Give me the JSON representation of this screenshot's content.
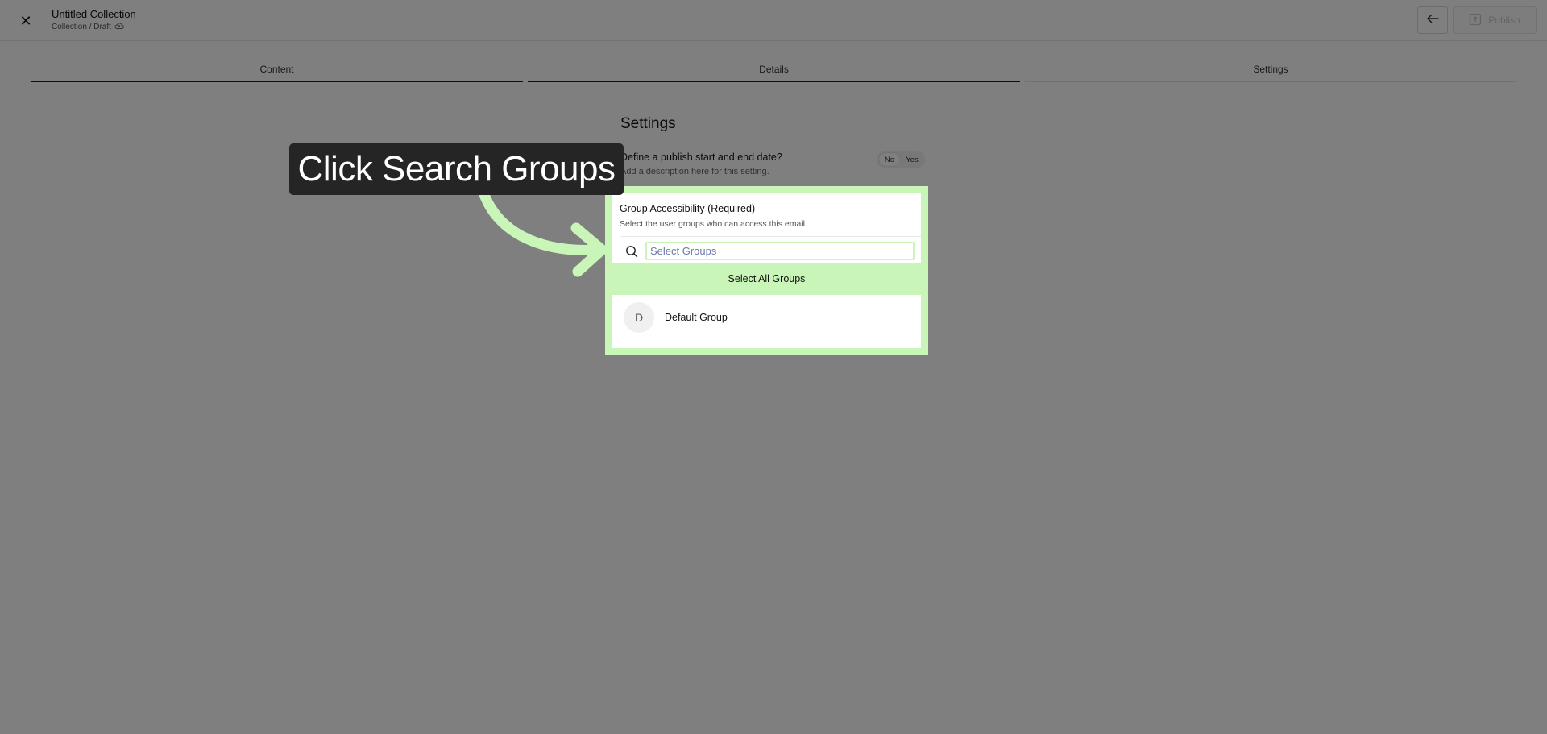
{
  "header": {
    "title": "Untitled Collection",
    "breadcrumb": "Collection / Draft",
    "publish_label": "Publish"
  },
  "tabs": [
    {
      "label": "Content",
      "active": false
    },
    {
      "label": "Details",
      "active": false
    },
    {
      "label": "Settings",
      "active": true
    }
  ],
  "settings": {
    "heading": "Settings",
    "publish_window": {
      "question": "Define a publish start and end date?",
      "description": "Add a description here for this setting.",
      "options": [
        "No",
        "Yes"
      ],
      "selected": "No"
    },
    "group_access": {
      "title": "Group Accessibility (Required)",
      "description": "Select the user groups who can access this email.",
      "search_placeholder": "Select Groups",
      "select_all_label": "Select All Groups",
      "groups": [
        {
          "initial": "D",
          "name": "Default Group"
        }
      ]
    }
  },
  "callout": {
    "text": "Click Search Groups"
  },
  "colors": {
    "highlight": "#c9f6b8",
    "callout_bg": "#252525"
  }
}
